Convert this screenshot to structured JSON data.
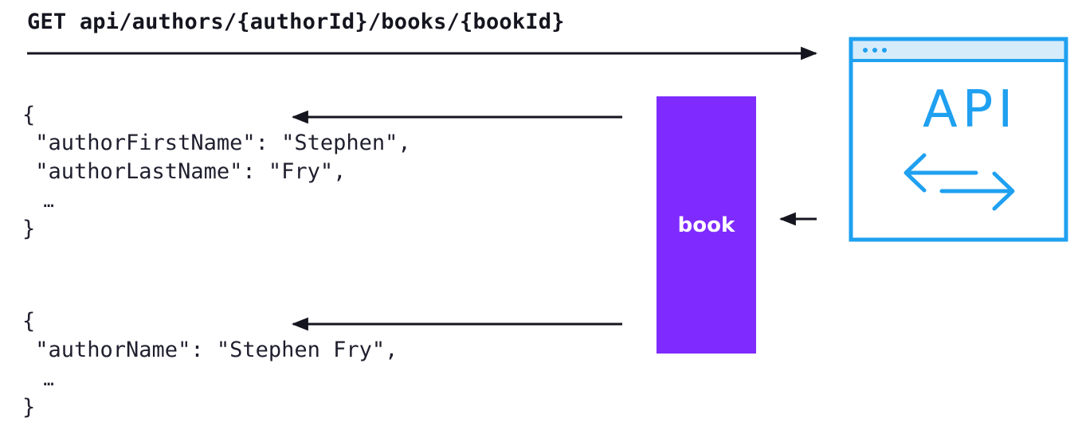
{
  "route": "GET api/authors/{authorId}/books/{bookId}",
  "response_one": {
    "open_brace": "{",
    "line1": " \"authorFirstName\": \"Stephen\",",
    "line2": " \"authorLastName\": \"Fry\",",
    "ellipsis": "  …",
    "close_brace": "}"
  },
  "response_two": {
    "open_brace": "{",
    "line1": " \"authorName\": \"Stephen Fry\",",
    "ellipsis": "  …",
    "close_brace": "}"
  },
  "book_box": {
    "label": "book",
    "color": "#7f2bff"
  },
  "api_window": {
    "label": "API",
    "color": "#1fa0f0",
    "titlebar_fill": "#d7ecfb",
    "icon": "api-exchange-icon"
  },
  "colors": {
    "arrow": "#15151f",
    "text": "#1f1f2e"
  }
}
